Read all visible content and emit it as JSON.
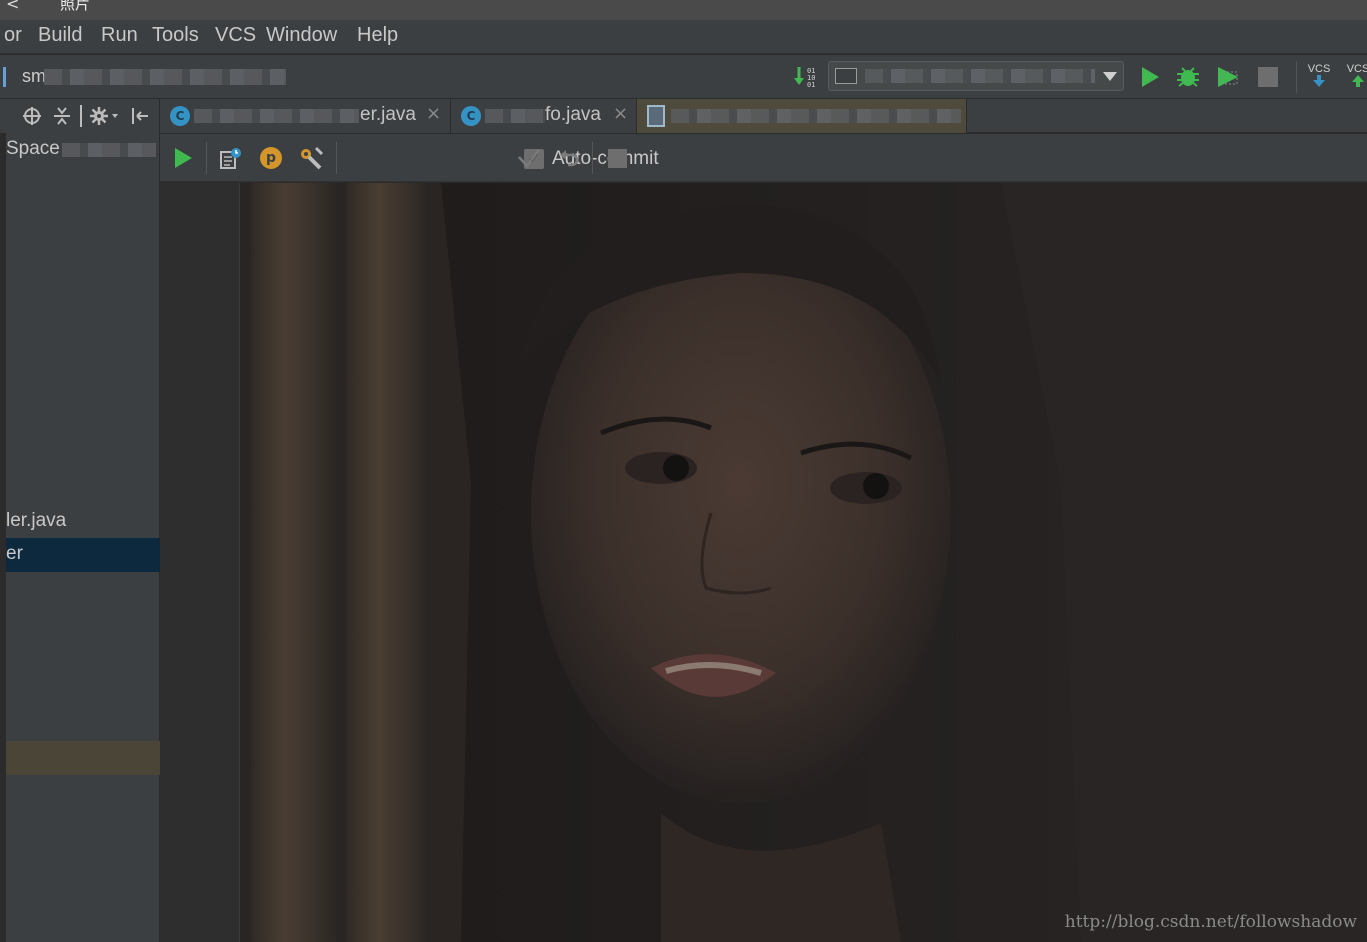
{
  "window": {
    "back_glyph": "<",
    "title": "照片"
  },
  "menu": [
    "or",
    "Build",
    "Run",
    "Tools",
    "VCS",
    "Window",
    "Help"
  ],
  "toolbar": {
    "project_name": "sm",
    "vcs_update": "VCS",
    "vcs_commit": "VCS"
  },
  "tabs": [
    {
      "label": "er.java",
      "close": "×"
    },
    {
      "label": "fo.java",
      "close": "×"
    }
  ],
  "sidebar": {
    "header": "Space",
    "items": [
      {
        "label": "ler.java"
      },
      {
        "label": "er"
      }
    ]
  },
  "console": {
    "auto_commit_label": "Auto-commit",
    "auto_commit_checked": true,
    "check_glyph": "✓",
    "p_glyph": "p"
  },
  "watermark": "http://blog.csdn.net/followshadow",
  "colors": {
    "accent_green": "#3fb950",
    "tab_class_icon": "#3592c4",
    "selection": "#0d293e"
  }
}
